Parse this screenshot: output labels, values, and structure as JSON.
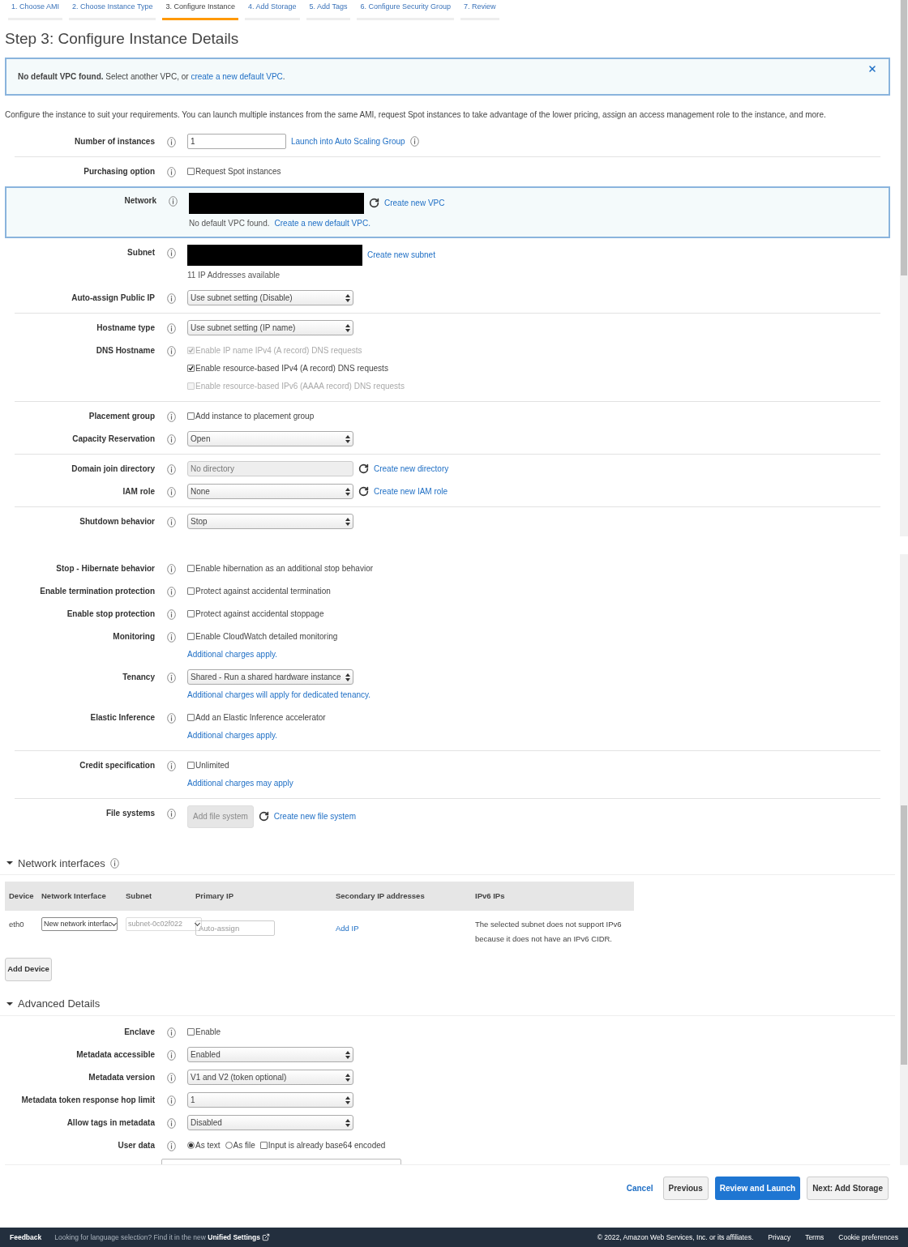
{
  "steps": [
    {
      "label": "1. Choose AMI",
      "selected": false
    },
    {
      "label": "2. Choose Instance Type",
      "selected": false
    },
    {
      "label": "3. Configure Instance",
      "selected": true
    },
    {
      "label": "4. Add Storage",
      "selected": false
    },
    {
      "label": "5. Add Tags",
      "selected": false
    },
    {
      "label": "6. Configure Security Group",
      "selected": false
    },
    {
      "label": "7. Review",
      "selected": false
    }
  ],
  "title": "Step 3: Configure Instance Details",
  "alert": {
    "text": "**No default VPC found.** Select another VPC, or",
    "link": "create a new default VPC",
    "end": "."
  },
  "intro": "Configure the instance to suit your requirements. You can launch multiple instances from the same AMI, request Spot instances to take advantage of the lower pricing, assign an access management role to the instance, and more.",
  "panels": [
    {
      "groups": [
        {
          "kind": "plain",
          "rows": [
            {
              "label": "Number of instances",
              "info": true,
              "lines": [
                [
                  {
                    "kind": "input",
                    "value": "1"
                  },
                  {
                    "kind": "link",
                    "text": "Launch into Auto Scaling Group"
                  },
                  {
                    "kind": "info"
                  }
                ]
              ]
            }
          ]
        },
        {
          "kind": "plain",
          "rows": [
            {
              "label": "Purchasing option",
              "info": true,
              "lines": [
                [
                  {
                    "kind": "checkbox",
                    "text": "Request Spot instances",
                    "checked": false,
                    "disabled": false
                  }
                ]
              ]
            }
          ]
        },
        {
          "kind": "callout",
          "rows": [
            {
              "label": "Network",
              "info": true,
              "lines": [
                [
                  {
                    "kind": "redacted"
                  },
                  {
                    "kind": "refresh"
                  },
                  {
                    "kind": "link",
                    "text": "Create new VPC"
                  }
                ],
                [
                  {
                    "kind": "note",
                    "text": "No default VPC found."
                  },
                  {
                    "kind": "link",
                    "text": "Create a new default VPC."
                  }
                ]
              ]
            }
          ]
        },
        {
          "kind": "plain",
          "rows": [
            {
              "label": "Subnet",
              "info": true,
              "lines": [
                [
                  {
                    "kind": "redacted"
                  },
                  {
                    "kind": "link",
                    "text": "Create new subnet"
                  }
                ],
                [
                  {
                    "kind": "note",
                    "text": "11 IP Addresses available"
                  }
                ]
              ]
            },
            {
              "label": "Auto-assign Public IP",
              "info": true,
              "lines": [
                [
                  {
                    "kind": "select",
                    "value": "Use subnet setting (Disable)",
                    "disabled": false
                  }
                ]
              ]
            }
          ]
        },
        {
          "kind": "plain",
          "rows": [
            {
              "label": "Hostname type",
              "info": true,
              "lines": [
                [
                  {
                    "kind": "select",
                    "value": "Use subnet setting (IP name)",
                    "disabled": false
                  }
                ]
              ]
            },
            {
              "label": "DNS Hostname",
              "info": true,
              "lines": [
                [
                  {
                    "kind": "checkbox",
                    "text": "Enable IP name IPv4 (A record) DNS requests",
                    "checked": true,
                    "disabled": true
                  }
                ],
                [
                  {
                    "kind": "checkbox",
                    "text": "Enable resource-based IPv4 (A record) DNS requests",
                    "checked": true,
                    "disabled": false
                  }
                ],
                [
                  {
                    "kind": "checkbox",
                    "text": "Enable resource-based IPv6 (AAAA record) DNS requests",
                    "checked": false,
                    "disabled": true
                  }
                ]
              ]
            }
          ]
        },
        {
          "kind": "plain",
          "rows": [
            {
              "label": "Placement group",
              "info": true,
              "lines": [
                [
                  {
                    "kind": "checkbox",
                    "text": "Add instance to placement group",
                    "checked": false,
                    "disabled": false
                  }
                ]
              ]
            },
            {
              "label": "Capacity Reservation",
              "info": true,
              "lines": [
                [
                  {
                    "kind": "select",
                    "value": "Open",
                    "disabled": false
                  }
                ]
              ]
            }
          ]
        },
        {
          "kind": "plain",
          "rows": [
            {
              "label": "Domain join directory",
              "info": true,
              "lines": [
                [
                  {
                    "kind": "select",
                    "value": "No directory",
                    "disabled": true
                  },
                  {
                    "kind": "refresh"
                  },
                  {
                    "kind": "link",
                    "text": "Create new directory"
                  }
                ]
              ]
            },
            {
              "label": "IAM role",
              "info": true,
              "lines": [
                [
                  {
                    "kind": "select",
                    "value": "None",
                    "disabled": false
                  },
                  {
                    "kind": "refresh"
                  },
                  {
                    "kind": "link",
                    "text": "Create new IAM role"
                  }
                ]
              ]
            }
          ]
        },
        {
          "kind": "plain",
          "rows": [
            {
              "label": "Shutdown behavior",
              "info": true,
              "lines": [
                [
                  {
                    "kind": "select",
                    "value": "Stop",
                    "disabled": false
                  }
                ]
              ]
            }
          ]
        }
      ]
    },
    {
      "groups": [
        {
          "kind": "plain",
          "rows": [
            {
              "label": "Stop - Hibernate behavior",
              "info": true,
              "lines": [
                [
                  {
                    "kind": "checkbox",
                    "text": "Enable hibernation as an additional stop behavior",
                    "checked": false,
                    "disabled": false
                  }
                ]
              ]
            },
            {
              "label": "Enable termination protection",
              "info": true,
              "lines": [
                [
                  {
                    "kind": "checkbox",
                    "text": "Protect against accidental termination",
                    "checked": false,
                    "disabled": false
                  }
                ]
              ]
            },
            {
              "label": "Enable stop protection",
              "info": true,
              "lines": [
                [
                  {
                    "kind": "checkbox",
                    "text": "Protect against accidental stoppage",
                    "checked": false,
                    "disabled": false
                  }
                ]
              ]
            },
            {
              "label": "Monitoring",
              "info": true,
              "lines": [
                [
                  {
                    "kind": "checkbox",
                    "text": "Enable CloudWatch detailed monitoring",
                    "checked": false,
                    "disabled": false
                  }
                ],
                [
                  {
                    "kind": "link",
                    "text": "Additional charges apply."
                  }
                ]
              ]
            },
            {
              "label": "Tenancy",
              "info": true,
              "lines": [
                [
                  {
                    "kind": "select",
                    "value": "Shared - Run a shared hardware instance",
                    "disabled": false
                  }
                ],
                [
                  {
                    "kind": "link",
                    "text": "Additional charges will apply for dedicated tenancy."
                  }
                ]
              ]
            },
            {
              "label": "Elastic Inference",
              "info": true,
              "lines": [
                [
                  {
                    "kind": "checkbox",
                    "text": "Add an Elastic Inference accelerator",
                    "checked": false,
                    "disabled": false
                  }
                ],
                [
                  {
                    "kind": "link",
                    "text": "Additional charges apply."
                  }
                ]
              ]
            }
          ]
        },
        {
          "kind": "plain",
          "rows": [
            {
              "label": "Credit specification",
              "info": true,
              "lines": [
                [
                  {
                    "kind": "checkbox",
                    "text": "Unlimited",
                    "checked": false,
                    "disabled": false
                  }
                ],
                [
                  {
                    "kind": "link",
                    "text": "Additional charges may apply"
                  }
                ]
              ]
            }
          ]
        },
        {
          "kind": "plain",
          "rows": [
            {
              "label": "File systems",
              "info": true,
              "lines": [
                [
                  {
                    "kind": "button",
                    "text": "Add file system",
                    "disabled": true
                  },
                  {
                    "kind": "refresh"
                  },
                  {
                    "kind": "link",
                    "text": "Create new file system"
                  }
                ]
              ]
            }
          ]
        }
      ]
    }
  ],
  "network_interfaces": {
    "title": "Network interfaces",
    "expanded": true,
    "info": true,
    "columns": [
      "Device",
      "Network Interface",
      "Subnet",
      "Primary IP",
      "Secondary IP addresses",
      "IPv6 IPs"
    ],
    "rows": [
      {
        "cells": [
          {
            "kind": "text",
            "text": "eth0"
          },
          {
            "kind": "select",
            "value": "New network interfac",
            "disabled": false
          },
          {
            "kind": "select",
            "value": "subnet-0c02f022",
            "disabled": true
          },
          {
            "kind": "input",
            "placeholder": "Auto-assign"
          },
          {
            "kind": "link",
            "text": "Add IP"
          },
          {
            "kind": "text",
            "text": "The selected subnet does not support IPv6 because it does not have an IPv6 CIDR."
          }
        ]
      }
    ],
    "add_button": "Add Device"
  },
  "advanced": {
    "title": "Advanced Details",
    "expanded": true,
    "rows": [
      {
        "label": "Enclave",
        "info": true,
        "lines": [
          [
            {
              "kind": "checkbox",
              "text": "Enable",
              "checked": false,
              "disabled": false
            }
          ]
        ]
      },
      {
        "label": "Metadata accessible",
        "info": true,
        "lines": [
          [
            {
              "kind": "select",
              "value": "Enabled",
              "disabled": false
            }
          ]
        ]
      },
      {
        "label": "Metadata version",
        "info": true,
        "lines": [
          [
            {
              "kind": "select",
              "value": "V1 and V2 (token optional)",
              "disabled": false
            }
          ]
        ]
      },
      {
        "label": "Metadata token response hop limit",
        "info": true,
        "lines": [
          [
            {
              "kind": "select",
              "value": "1",
              "disabled": false
            }
          ]
        ]
      },
      {
        "label": "Allow tags in metadata",
        "info": true,
        "lines": [
          [
            {
              "kind": "select",
              "value": "Disabled",
              "disabled": false
            }
          ]
        ]
      },
      {
        "label": "User data",
        "info": true,
        "lines": [
          [
            {
              "kind": "radio",
              "text": "As text",
              "selected": true
            },
            {
              "kind": "radio",
              "text": "As file",
              "selected": false
            },
            {
              "kind": "checkbox",
              "text": "Input is already base64 encoded",
              "checked": false,
              "disabled": false
            }
          ]
        ]
      }
    ]
  },
  "actions": [
    {
      "kind": "link",
      "label": "Cancel"
    },
    {
      "kind": "default",
      "label": "Previous"
    },
    {
      "kind": "primary",
      "label": "Review and Launch"
    },
    {
      "kind": "default",
      "label": "Next: Add Storage"
    }
  ],
  "footer": {
    "feedback": "Feedback",
    "notice": "Looking for language selection? Find it in the new",
    "notice_link": "Unified Settings",
    "copyright": "© 2022, Amazon Web Services, Inc. or its affiliates.",
    "links": [
      "Privacy",
      "Terms",
      "Cookie preferences"
    ]
  }
}
